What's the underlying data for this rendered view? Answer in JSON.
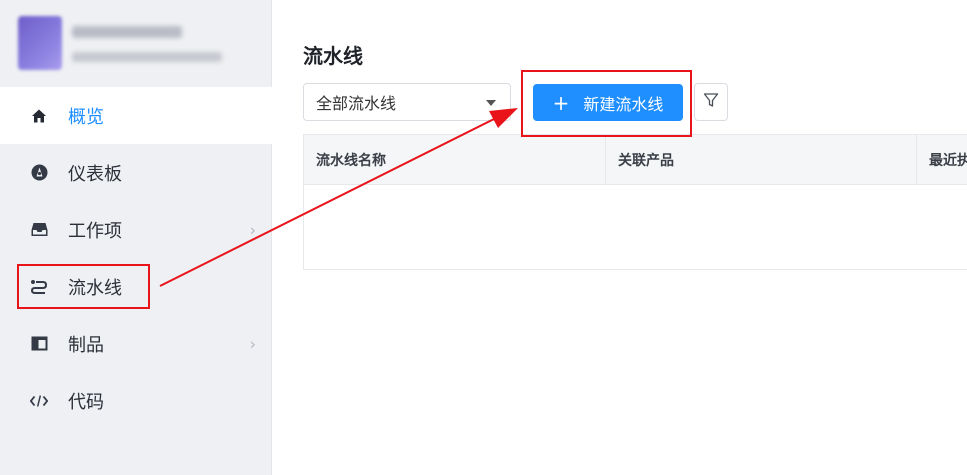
{
  "sidebar": {
    "items": [
      {
        "label": "概览",
        "icon": "home-icon",
        "active": true
      },
      {
        "label": "仪表板",
        "icon": "dashboard-icon",
        "active": false
      },
      {
        "label": "工作项",
        "icon": "inbox-icon",
        "active": false,
        "has_chevron": true
      },
      {
        "label": "流水线",
        "icon": "pipeline-icon",
        "active": false
      },
      {
        "label": "制品",
        "icon": "artifact-icon",
        "active": false,
        "has_chevron": true
      },
      {
        "label": "代码",
        "icon": "code-icon",
        "active": false
      }
    ],
    "chevron": "›"
  },
  "main": {
    "title": "流水线",
    "filter_select": {
      "value": "全部流水线"
    },
    "create_button": {
      "icon": "plus-icon",
      "plus": "+",
      "label": "新建流水线"
    },
    "filter_button": {
      "icon": "filter-icon"
    },
    "table": {
      "columns": [
        "流水线名称",
        "关联产品",
        "最近执行"
      ]
    }
  },
  "colors": {
    "accent": "#1f8fff",
    "sidebar_bg": "#eef0f3",
    "annotation": "#e8141a"
  }
}
